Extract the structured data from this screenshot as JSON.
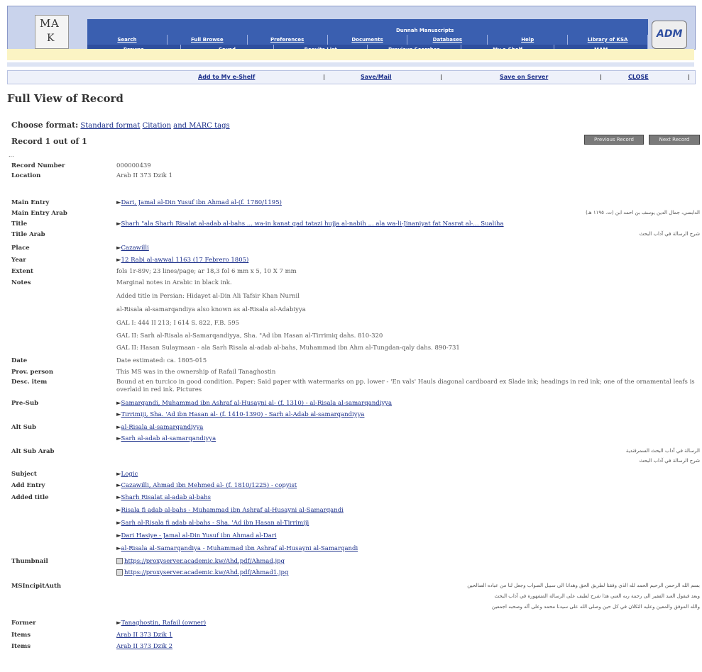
{
  "header": {
    "logo_letters": [
      "M",
      "A",
      "K"
    ],
    "site_title": "Dunnah Manuscripts",
    "nav_row1": [
      "Search",
      "Full Browse",
      "Preferences",
      "Documents",
      "Databases",
      "Help",
      "Library of KSA"
    ],
    "nav_row2": [
      "Browse",
      "Saved",
      "Results List",
      "Previous Searches",
      "My e-Shelf",
      "MAM"
    ],
    "adm_logo": "ADM"
  },
  "actions": {
    "add_shelf": "Add to My e-Shelf",
    "save_mail": "Save/Mail",
    "save_server": "Save on Server",
    "close": "CLOSE",
    "sep": "|"
  },
  "page": {
    "title": "Full View of Record",
    "choose_label": "Choose format:",
    "formats": [
      "Standard format",
      "Citation",
      "and MARC tags"
    ],
    "record_of": "Record 1 out of 1",
    "btn_prev": "Previous Record",
    "btn_next": "Next Record",
    "dots": "..."
  },
  "record": {
    "mark": "►",
    "record_number": {
      "label": "Record Number",
      "value": "000000439"
    },
    "location": {
      "label": "Location",
      "value": "Arab II 373 Dzik 1"
    },
    "main_entry": {
      "label": "Main Entry",
      "value": "Dari, Jamal al-Din Yusuf ibn Ahmad al-(f. 1780/1195)"
    },
    "main_entry_arab": {
      "label": "Main Entry Arab",
      "value": "الدابسي، جمال الدين يوسف بن احمد ابن (ت. ١١٩٥ هـ)"
    },
    "title": {
      "label": "Title",
      "value": "Sharh \"ala Sharh Risalat al-adab al-bahs ... wa-in kanat qad tatazi hujja al-nabih ... ala wa-li-Jinaniyat fat Nasrat al-... Sualiha"
    },
    "title_arab": {
      "label": "Title Arab",
      "value": "شرح الرسالة في آداب البحث"
    },
    "place": {
      "label": "Place",
      "value": "Cazawilli"
    },
    "year": {
      "label": "Year",
      "value": "12 Rabi al-awwal 1163 (17 Febrero 1805)"
    },
    "extent": {
      "label": "Extent",
      "value": "fols 1r-89v; 23 lines/page; ar 18,3 fol 6 mm x 5, 10 X 7 mm"
    },
    "notes": {
      "label": "Notes",
      "lines": [
        "Marginal notes in Arabic in black ink.",
        "Added title in Persian: Hidayet al-Din Ali Tafsir Khan Nurnil",
        "al-Risala al-samarqandiya also known as al-Risala al-Adabiyya",
        "GAL I: 444 II 213; I 614 S. 822, F.B. 595",
        "GAL II: Sarh al-Risala al-Samarqandiyya, Sha. \"Ad ibn Hasan al-Tirrimiq dahs. 810-320",
        "GAL II: Hasan Sulaymaan - ala Sarh Risala al-adab al-bahs, Muhammad ibn Ahm al-Tungdan-qaly dahs. 890-731"
      ]
    },
    "date": {
      "label": "Date",
      "value": "Date estimated: ca. 1805-015"
    },
    "prov": {
      "label": "Prov. person",
      "value": "This MS was in the ownership of Rafail Tanaghostin"
    },
    "desc": {
      "label": "Desc. item",
      "value": "Bound at en turcico in good condition. Paper: Said paper with watermarks on pp. lower - 'En vals' Hauls diagonal cardboard ex Slade ink; headings in red ink; one of the ornamental leafs is overlaid in red ink. Pictures"
    },
    "pre_sub": {
      "label": "Pre-Sub",
      "values": [
        "Samarqandi, Muhammad ibn Ashraf al-Husayni al- (f. 1310) - al-Risala al-samarqandiyya",
        "Tirrimiji, Sha. 'Ad ibn Hasan al- (f. 1410-1390) - Sarh al-Adab al-samarqandiyya"
      ]
    },
    "alt_sub": {
      "label": "Alt Sub",
      "values": [
        "al-Risala al-samarqandiyya",
        "Sarh al-adab al-samarqandiyya"
      ]
    },
    "alt_sub_arab": {
      "label": "Alt Sub Arab",
      "values": [
        "الرسالة في آداب البحث السمرقندية",
        "شرح الرسالة في آداب البحث"
      ]
    },
    "subject": {
      "label": "Subject",
      "value": "Logic"
    },
    "add_entry": {
      "label": "Add Entry",
      "value": "Cazawilli, Ahmad ibn Mehmed al- (f. 1810/1225) - copyist"
    },
    "added_title": {
      "label": "Added title",
      "values": [
        "Sharh Risalat al-adab al-bahs",
        "Risala fi adab al-bahs - Muhammad ibn Ashraf al-Husayni al-Samarqandi",
        "Sarh al-Risala fi adab al-bahs - Sha. 'Ad ibn Hasan al-Tirrimiji",
        "Dari Hasiye - Jamal al-Din Yusuf ibn Ahmad al-Dari",
        "al-Risala al-Samarqandiya - Muhammad ibn Ashraf al-Husayni al-Samarqandi"
      ]
    },
    "thumbnail": {
      "label": "Thumbnail",
      "values": [
        "https://proxyserver.academic.kw/Ahd.pdf/Ahmad.jpg",
        "https://proxyserver.academic.kw/Ahd.pdf/Ahmad1.jpg"
      ]
    },
    "ms_incipit": {
      "label": "MSIncipitAuth",
      "lines": [
        "بسم الله الرحمن الرحيم الحمد لله الذي وفقنا لطريق الحق وهدانا الى سبيل الصواب وجعل لنا من عباده الصالحين",
        "وبعد فيقول العبد الفقير الى رحمة ربه الغني هذا شرح لطيف على الرسالة المشهورة في آداب البحث",
        "والله الموفق والمعين وعليه التكلان في كل حين وصلى الله على سيدنا محمد وعلى آله وصحبه اجمعين"
      ]
    },
    "former": {
      "label": "Former",
      "value": "Tanaghostin, Rafail (owner)"
    },
    "items1": {
      "label": "Items",
      "value": "Arab II 373 Dzik 1"
    },
    "items2": {
      "label": "Items",
      "value": "Arab II 373 Dzik 2"
    }
  },
  "colors": {
    "nav": "#3a5fb0",
    "topbar": "#c9d3ec",
    "link": "#1b2f8a",
    "banner": "#fbf4c4"
  }
}
